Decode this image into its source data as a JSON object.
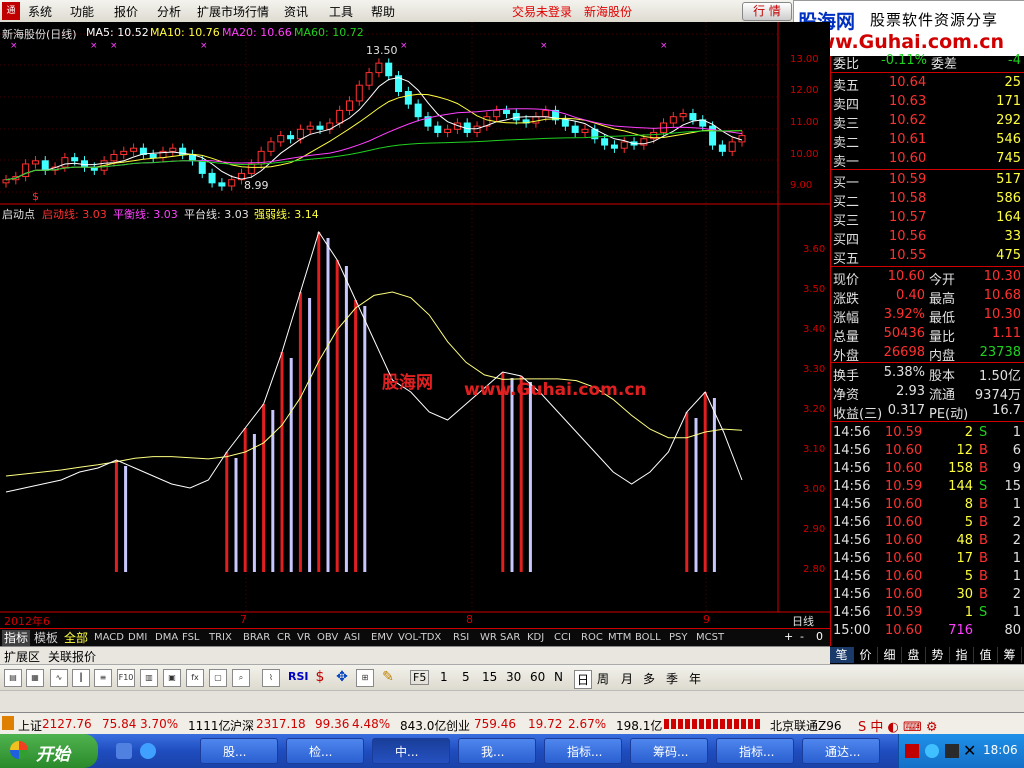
{
  "menu": {
    "items": [
      "系统",
      "功能",
      "报价",
      "分析",
      "扩展市场行情",
      "资讯",
      "工具",
      "帮助"
    ],
    "login_status": "交易未登录",
    "stock_short": "新海股份",
    "hq_button": "行 情"
  },
  "banner": {
    "brand": "股海网",
    "slogan": "股票软件资源分享",
    "url": "www.Guhai.com.cn"
  },
  "chart": {
    "title": "新海股份(日线)",
    "ma5": "MA5: 10.52",
    "ma10": "MA10: 10.76",
    "ma20": "MA20: 10.66",
    "ma60": "MA60: 10.72",
    "high_label": "13.50",
    "low_label": "8.99",
    "signal_mark": "$",
    "price_ticks": [
      "13.00",
      "12.00",
      "11.00",
      "10.00",
      "9.00"
    ],
    "indicator_name": "启动点",
    "ind_qd": "启动线: 3.03",
    "ind_ph": "平衡线: 3.03",
    "ind_pt": "平台线: 3.03",
    "ind_qr": "强弱线: 3.14",
    "ind_ticks": [
      "3.60",
      "3.50",
      "3.40",
      "3.30",
      "3.20",
      "3.10",
      "3.00",
      "2.90",
      "2.80"
    ],
    "watermark_cn": "股海网",
    "watermark_url": "www.Guhai.com.cn",
    "date_labels": [
      "2012年6",
      "7",
      "8",
      "9"
    ],
    "period_label": "日线"
  },
  "indicator_tabs": [
    "指标",
    "模板",
    "全部",
    "MACD",
    "DMI",
    "DMA",
    "FSL",
    "TRIX",
    "BRAR",
    "CR",
    "VR",
    "OBV",
    "ASI",
    "EMV",
    "VOL-TDX",
    "RSI",
    "WR",
    "SAR",
    "KDJ",
    "CCI",
    "ROC",
    "MTM",
    "BOLL",
    "PSY",
    "MCST"
  ],
  "zoom_controls": [
    "+",
    "-",
    "0"
  ],
  "expand_tabs": [
    "扩展区",
    "关联报价"
  ],
  "quote": {
    "weibi_label": "委比",
    "weibi": "-0.11%",
    "weicha_label": "委差",
    "weicha": "-4",
    "sells": [
      {
        "label": "卖五",
        "price": "10.64",
        "vol": "25"
      },
      {
        "label": "卖四",
        "price": "10.63",
        "vol": "171"
      },
      {
        "label": "卖三",
        "price": "10.62",
        "vol": "292"
      },
      {
        "label": "卖二",
        "price": "10.61",
        "vol": "546"
      },
      {
        "label": "卖一",
        "price": "10.60",
        "vol": "745"
      }
    ],
    "buys": [
      {
        "label": "买一",
        "price": "10.59",
        "vol": "517"
      },
      {
        "label": "买二",
        "price": "10.58",
        "vol": "586"
      },
      {
        "label": "买三",
        "price": "10.57",
        "vol": "164"
      },
      {
        "label": "买四",
        "price": "10.56",
        "vol": "33"
      },
      {
        "label": "买五",
        "price": "10.55",
        "vol": "475"
      }
    ],
    "stats": [
      {
        "l1": "现价",
        "v1": "10.60",
        "l2": "今开",
        "v2": "10.30"
      },
      {
        "l1": "涨跌",
        "v1": "0.40",
        "l2": "最高",
        "v2": "10.68"
      },
      {
        "l1": "涨幅",
        "v1": "3.92%",
        "l2": "最低",
        "v2": "10.30"
      },
      {
        "l1": "总量",
        "v1": "50436",
        "l2": "量比",
        "v2": "1.11"
      },
      {
        "l1": "外盘",
        "v1": "26698",
        "l2": "内盘",
        "v2": "23738"
      }
    ],
    "fin": [
      {
        "l1": "换手",
        "v1": "5.38%",
        "l2": "股本",
        "v2": "1.50亿"
      },
      {
        "l1": "净资",
        "v1": "2.93",
        "l2": "流通",
        "v2": "9374万"
      },
      {
        "l1": "收益(三)",
        "v1": "0.317",
        "l2": "PE(动)",
        "v2": "16.7"
      }
    ],
    "ticks": [
      {
        "t": "14:56",
        "p": "10.59",
        "v": "2",
        "bs": "S",
        "n": "1"
      },
      {
        "t": "14:56",
        "p": "10.60",
        "v": "12",
        "bs": "B",
        "n": "6"
      },
      {
        "t": "14:56",
        "p": "10.60",
        "v": "158",
        "bs": "B",
        "n": "9"
      },
      {
        "t": "14:56",
        "p": "10.59",
        "v": "144",
        "bs": "S",
        "n": "15"
      },
      {
        "t": "14:56",
        "p": "10.60",
        "v": "8",
        "bs": "B",
        "n": "1"
      },
      {
        "t": "14:56",
        "p": "10.60",
        "v": "5",
        "bs": "B",
        "n": "2"
      },
      {
        "t": "14:56",
        "p": "10.60",
        "v": "48",
        "bs": "B",
        "n": "2"
      },
      {
        "t": "14:56",
        "p": "10.60",
        "v": "17",
        "bs": "B",
        "n": "1"
      },
      {
        "t": "14:56",
        "p": "10.60",
        "v": "5",
        "bs": "B",
        "n": "1"
      },
      {
        "t": "14:56",
        "p": "10.60",
        "v": "30",
        "bs": "B",
        "n": "2"
      },
      {
        "t": "14:56",
        "p": "10.59",
        "v": "1",
        "bs": "S",
        "n": "1"
      },
      {
        "t": "15:00",
        "p": "10.60",
        "v": "716",
        "bs": "",
        "n": "80"
      }
    ]
  },
  "right_tabs": [
    "笔",
    "价",
    "细",
    "盘",
    "势",
    "指",
    "值",
    "筹"
  ],
  "periods": [
    "1",
    "5",
    "15",
    "30",
    "60",
    "N",
    "日",
    "周",
    "月",
    "多",
    "季",
    "年"
  ],
  "toolbar_labels": {
    "rsi": "RSI",
    "f5": "F5"
  },
  "status": {
    "sh_label": "上证",
    "sh_index": "2127.76",
    "sh_chg": "75.84",
    "sh_pct": "3.70%",
    "sh_amt": "1111亿",
    "sz_label": "沪深",
    "sz_index": "2317.18",
    "sz_chg": "99.36",
    "sz_pct": "4.48%",
    "sz_amt": "843.0亿",
    "cy_label": "创业",
    "cy_index": "759.46",
    "cy_chg": "19.72",
    "cy_pct": "2.67%",
    "cy_amt": "198.1亿",
    "server": "北京联通Z96"
  },
  "taskbar": {
    "start": "开始",
    "tasks": [
      "股...",
      "检...",
      "中...",
      "我...",
      "指标...",
      "筹码...",
      "指标...",
      "通达..."
    ],
    "clock": "18:06"
  },
  "colors": {
    "up": "#ff3030",
    "down": "#40ffff",
    "ma5": "#ffffff",
    "ma10": "#ffff40",
    "ma20": "#ff40ff",
    "ma60": "#20d020"
  },
  "price_series": [
    9.2,
    9.3,
    9.7,
    9.8,
    9.5,
    9.6,
    9.9,
    9.8,
    9.6,
    9.5,
    9.8,
    10.0,
    10.1,
    10.2,
    10.0,
    9.9,
    10.1,
    10.2,
    10.0,
    9.8,
    9.4,
    9.1,
    9.0,
    9.2,
    9.4,
    9.7,
    10.1,
    10.4,
    10.6,
    10.5,
    10.8,
    10.9,
    10.8,
    11.0,
    11.4,
    11.7,
    12.2,
    12.6,
    12.9,
    12.5,
    12.0,
    11.6,
    11.2,
    10.9,
    10.7,
    10.8,
    11.0,
    10.7,
    10.9,
    11.2,
    11.4,
    11.3,
    11.1,
    11.0,
    11.2,
    11.4,
    11.1,
    10.9,
    10.7,
    10.8,
    10.5,
    10.3,
    10.2,
    10.4,
    10.3,
    10.5,
    10.7,
    11.0,
    11.2,
    11.3,
    11.1,
    10.9,
    10.3,
    10.1,
    10.4,
    10.6
  ],
  "qd_series": [
    3.0,
    3.01,
    3.02,
    3.03,
    3.05,
    3.06,
    3.08,
    3.06,
    3.04,
    3.02,
    3.01,
    3.03,
    3.1,
    3.16,
    3.22,
    3.35,
    3.5,
    3.65,
    3.58,
    3.48,
    3.38,
    3.28,
    3.25,
    3.2,
    3.18,
    3.22,
    3.26,
    3.3,
    3.29,
    3.25,
    3.2,
    3.15,
    3.1,
    3.05,
    3.02,
    3.05,
    3.1,
    3.2,
    3.25,
    3.15,
    3.03
  ]
}
